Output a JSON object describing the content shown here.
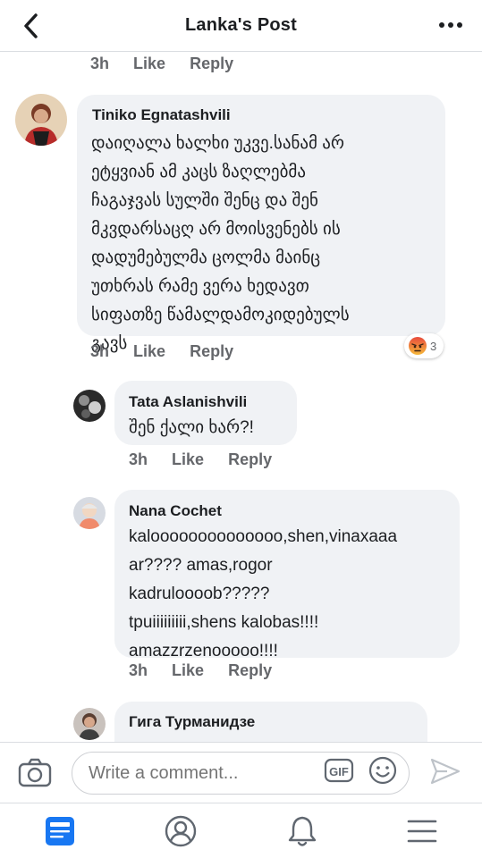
{
  "header": {
    "title": "Lanka's Post",
    "back_icon": "chevron-left-icon",
    "more_icon": "more-horizontal-icon"
  },
  "top_actions": {
    "time": "3h",
    "like": "Like",
    "reply": "Reply"
  },
  "comments": [
    {
      "author": "Tiniko Egnatashvili",
      "lines": [
        "დაიღალა ხალხი უკვე.სანამ არ",
        "ეტყვიან ამ კაცს ზაღლებმა",
        "ჩაგაჯვას სულში შენც და შენ",
        "მკვდარსაცღ არ მოისვენებს ის",
        "დადუმებულმა ცოლმა მაინც",
        "უთხრას რამე ვერა ხედავთ",
        "სიფათზე წამალდამოკიდებულს",
        "გავს"
      ],
      "time": "3h",
      "like": "Like",
      "reply": "Reply",
      "reaction": {
        "icon": "angry-reaction-icon",
        "count": "3"
      }
    },
    {
      "author": "Tata Aslanishvili",
      "lines": [
        "შენ ქალი ხარ?!"
      ],
      "time": "3h",
      "like": "Like",
      "reply": "Reply"
    },
    {
      "author": "Nana Cochet",
      "lines": [
        "kaloooooooooooooo,shen,vinaxaaa",
        "ar???? amas,rogor",
        "kadruloooob?????",
        "tpuiiiiiiiii,shens kalobas!!!!",
        "amazzrzenooooo!!!!"
      ],
      "time": "3h",
      "like": "Like",
      "reply": "Reply"
    },
    {
      "author": "Гига Турманидзе",
      "lines": []
    }
  ],
  "composer": {
    "placeholder": "Write a comment...",
    "camera_icon": "camera-icon",
    "gif_label": "GIF",
    "emoji_icon": "emoji-icon",
    "send_icon": "send-icon"
  },
  "tabs": [
    {
      "name": "feed",
      "icon": "news-feed-icon",
      "active": true
    },
    {
      "name": "profile",
      "icon": "profile-icon",
      "active": false
    },
    {
      "name": "notifications",
      "icon": "bell-icon",
      "active": false
    },
    {
      "name": "menu",
      "icon": "hamburger-menu-icon",
      "active": false
    }
  ],
  "colors": {
    "accent": "#1877f2",
    "text": "#1c1e21",
    "secondary_text": "#65676b",
    "bubble": "#f0f2f5",
    "divider": "#dadde1"
  }
}
